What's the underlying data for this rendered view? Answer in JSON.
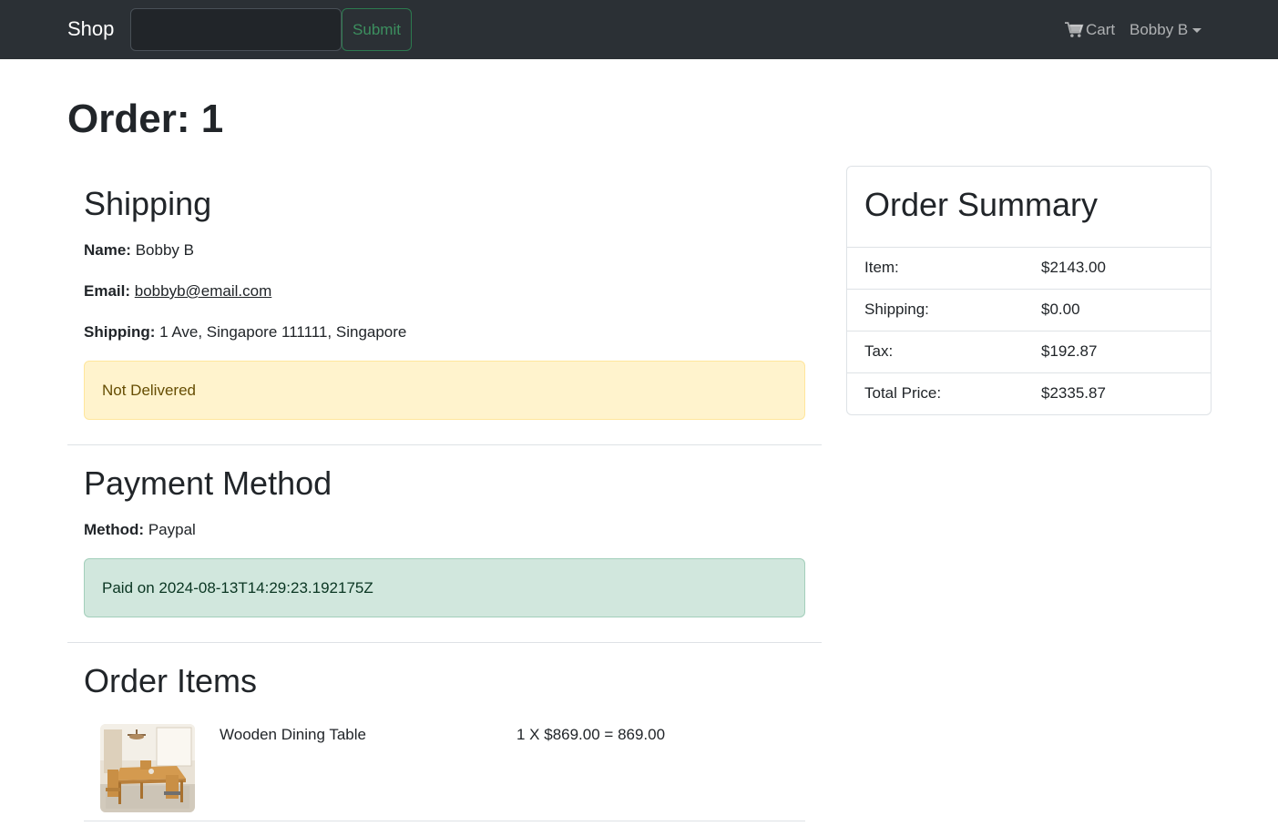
{
  "navbar": {
    "brand": "Shop",
    "search": {
      "value": "",
      "placeholder": ""
    },
    "submit_label": "Submit",
    "cart_label": "Cart",
    "user_label": "Bobby B"
  },
  "page": {
    "title": "Order: 1"
  },
  "shipping": {
    "heading": "Shipping",
    "name_label": "Name:",
    "name_value": "Bobby B",
    "email_label": "Email:",
    "email_value": "bobbyb@email.com",
    "address_label": "Shipping:",
    "address_value": "1 Ave, Singapore 111111, Singapore",
    "status": "Not Delivered"
  },
  "payment": {
    "heading": "Payment Method",
    "method_label": "Method:",
    "method_value": "Paypal",
    "status": "Paid on 2024-08-13T14:29:23.192175Z"
  },
  "order_items": {
    "heading": "Order Items",
    "items": [
      {
        "name": "Wooden Dining Table",
        "calc": "1 X $869.00 = 869.00"
      }
    ]
  },
  "summary": {
    "title": "Order Summary",
    "rows": [
      {
        "label": "Item:",
        "value": "$2143.00"
      },
      {
        "label": "Shipping:",
        "value": "$0.00"
      },
      {
        "label": "Tax:",
        "value": "$192.87"
      },
      {
        "label": "Total Price:",
        "value": "$2335.87"
      }
    ]
  },
  "colors": {
    "navbar_bg": "#2b3035",
    "warning_bg": "#fff3cd",
    "success_bg": "#d1e7dd",
    "submit_green": "#3c8f5f"
  }
}
